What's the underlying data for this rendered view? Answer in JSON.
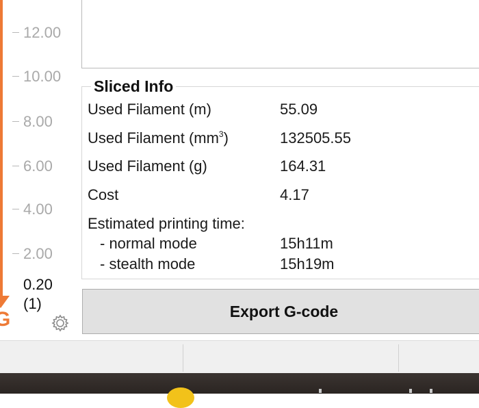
{
  "layer_slider": {
    "ticks": [
      "12.00",
      "10.00",
      "8.00",
      "6.00",
      "4.00",
      "2.00"
    ],
    "current_height": "0.20",
    "current_layer": "(1)",
    "settings_icon": "gear-icon",
    "accent_color": "#ee7a36"
  },
  "sliced_info": {
    "title": "Sliced Info",
    "used_filament_m_label": "Used Filament (m)",
    "used_filament_m_value": "55.09",
    "used_filament_mm3_label": "Used Filament (mm",
    "used_filament_mm3_sup": "3",
    "used_filament_mm3_close": ")",
    "used_filament_mm3_value": "132505.55",
    "used_filament_g_label": "Used Filament (g)",
    "used_filament_g_value": "164.31",
    "cost_label": "Cost",
    "cost_value": "4.17",
    "print_time_label": "Estimated printing time:",
    "normal_mode_label": "- normal mode",
    "normal_mode_value": "15h11m",
    "stealth_mode_label": "- stealth mode",
    "stealth_mode_value": "15h19m"
  },
  "actions": {
    "export_label": "Export G-code"
  }
}
